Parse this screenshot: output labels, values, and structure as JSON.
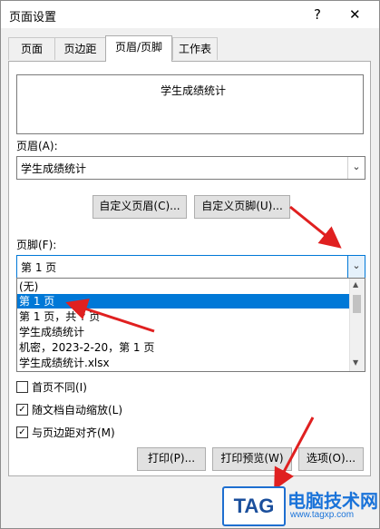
{
  "window": {
    "title": "页面设置",
    "help_glyph": "?",
    "close_glyph": "✕"
  },
  "tabs": [
    {
      "label": "页面"
    },
    {
      "label": "页边距"
    },
    {
      "label": "页眉/页脚"
    },
    {
      "label": "工作表"
    }
  ],
  "header": {
    "preview_text": "学生成绩统计",
    "label": "页眉(A):",
    "value": "学生成绩统计",
    "custom_button": "自定义页眉(C)..."
  },
  "footer": {
    "custom_button": "自定义页脚(U)...",
    "label": "页脚(F):",
    "value": "第 1 页",
    "options": [
      "(无)",
      "第 1 页",
      "第 1 页，共 ? 页",
      "学生成绩统计",
      " 机密，2023-2-20，第 1 页",
      "学生成绩统计.xlsx"
    ],
    "selected_index": 1
  },
  "checkboxes": [
    {
      "label": "首页不同(I)",
      "checked": false
    },
    {
      "label": "随文档自动缩放(L)",
      "checked": true
    },
    {
      "label": "与页边距对齐(M)",
      "checked": true
    }
  ],
  "buttons": {
    "print": "打印(P)...",
    "preview": "打印预览(W)",
    "options": "选项(O)..."
  },
  "watermark": {
    "tag": "TAG",
    "name": "电脑技术网",
    "url": "www.tagxp.com"
  },
  "colors": {
    "accent": "#0078d7",
    "annotation_arrow": "#e02020"
  }
}
